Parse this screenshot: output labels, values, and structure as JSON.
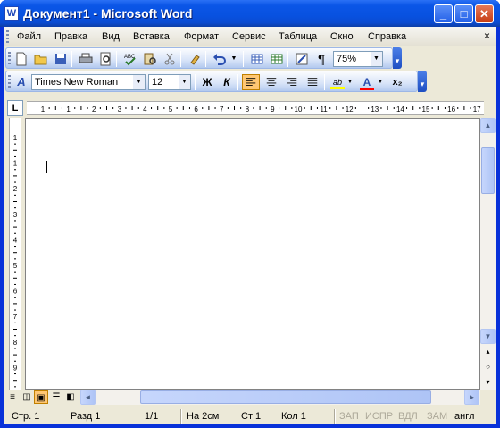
{
  "window": {
    "title": "Документ1 - Microsoft Word",
    "icon_letter": "W"
  },
  "title_buttons": {
    "minimize": "_",
    "maximize": "□",
    "close": "✕"
  },
  "menu": [
    "Файл",
    "Правка",
    "Вид",
    "Вставка",
    "Формат",
    "Сервис",
    "Таблица",
    "Окно",
    "Справка"
  ],
  "standard_toolbar": {
    "icons": [
      "new-document-icon",
      "open-folder-icon",
      "save-icon",
      "print-icon",
      "print-preview-icon",
      "spelling-icon",
      "research-icon",
      "cut-icon",
      "format-painter-icon",
      "undo-icon",
      "undo-dropdown-icon",
      "insert-table-icon",
      "insert-excel-icon",
      "drawing-icon",
      "show-marks-icon"
    ],
    "zoom": "75%",
    "pilcrow": "¶"
  },
  "formatting_toolbar": {
    "style_glyph": "A",
    "font_name": "Times New Roman",
    "font_size": "12",
    "bold": "Ж",
    "italic": "К",
    "highlight_color": "#ffff00",
    "font_color": "#ff0000",
    "subscript": "x₂"
  },
  "ruler": {
    "corner": "L",
    "h_labels": [
      "1",
      "1",
      "2",
      "3",
      "4",
      "5",
      "6",
      "7",
      "8",
      "9",
      "10",
      "11",
      "12",
      "13",
      "14",
      "15",
      "16",
      "17"
    ],
    "v_labels": [
      "1",
      "1",
      "2",
      "3",
      "4",
      "5",
      "6",
      "7",
      "8",
      "9"
    ]
  },
  "scrollbars": {
    "up": "▲",
    "down": "▼",
    "left": "◄",
    "right": "►",
    "prev_page": "▴",
    "select_browse": "○",
    "next_page": "▾"
  },
  "view_buttons": [
    "normal-view-icon",
    "web-layout-icon",
    "print-layout-icon",
    "outline-view-icon",
    "reading-layout-icon"
  ],
  "status": {
    "page": "Стр. 1",
    "section": "Разд 1",
    "pages": "1/1",
    "at": "На 2см",
    "line": "Ст 1",
    "col": "Кол 1",
    "rec": "ЗАП",
    "trk": "ИСПР",
    "ext": "ВДЛ",
    "ovr": "ЗАМ",
    "lang": "англ"
  }
}
